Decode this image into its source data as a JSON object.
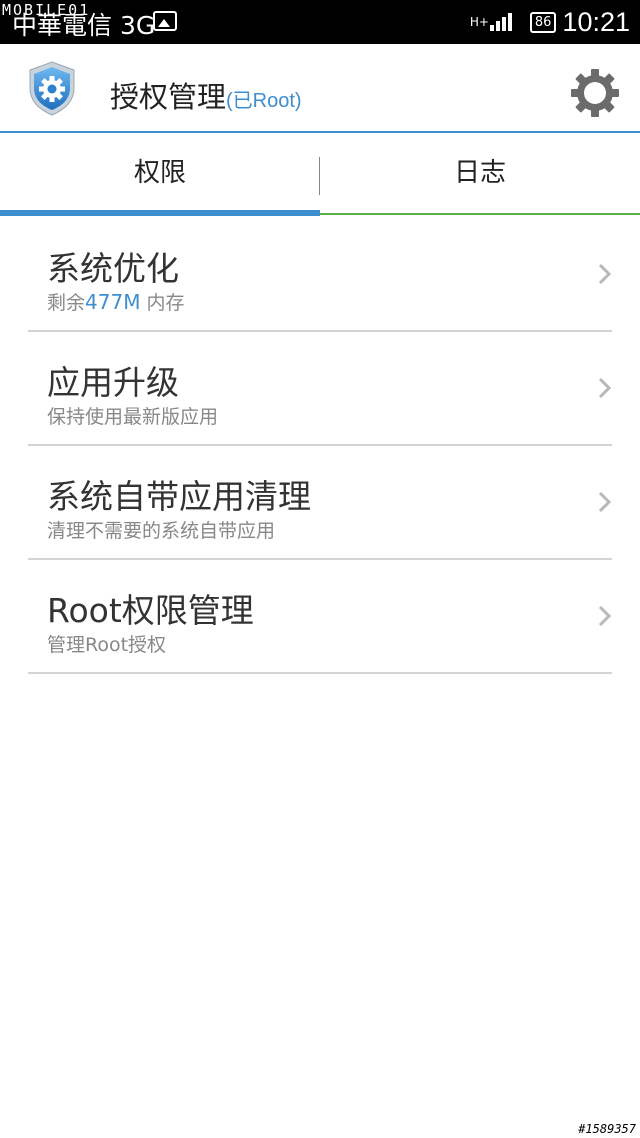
{
  "status_bar": {
    "watermark": "MOBILE01",
    "carrier": "中華電信 3G",
    "network_type": "H+",
    "battery": "86",
    "time": "10:21"
  },
  "app_bar": {
    "title": "授权管理",
    "subtitle": "(已Root)",
    "icon": "shield-gear-icon",
    "settings_icon": "gear-icon"
  },
  "tabs": [
    {
      "label": "权限",
      "active": true
    },
    {
      "label": "日志",
      "active": false
    }
  ],
  "list": [
    {
      "title": "系统优化",
      "sub_prefix": "剩余",
      "sub_highlight": "477M",
      "sub_suffix": " 内存"
    },
    {
      "title": "应用升级",
      "subtitle": "保持使用最新版应用"
    },
    {
      "title": "系统自带应用清理",
      "subtitle": "清理不需要的系统自带应用"
    },
    {
      "title": "Root权限管理",
      "subtitle": "管理Root授权"
    }
  ],
  "footer_id": "#1589357",
  "colors": {
    "accent": "#3d8ed0",
    "tab_idle_line": "#5fb04a",
    "divider": "#d4d4d4"
  }
}
